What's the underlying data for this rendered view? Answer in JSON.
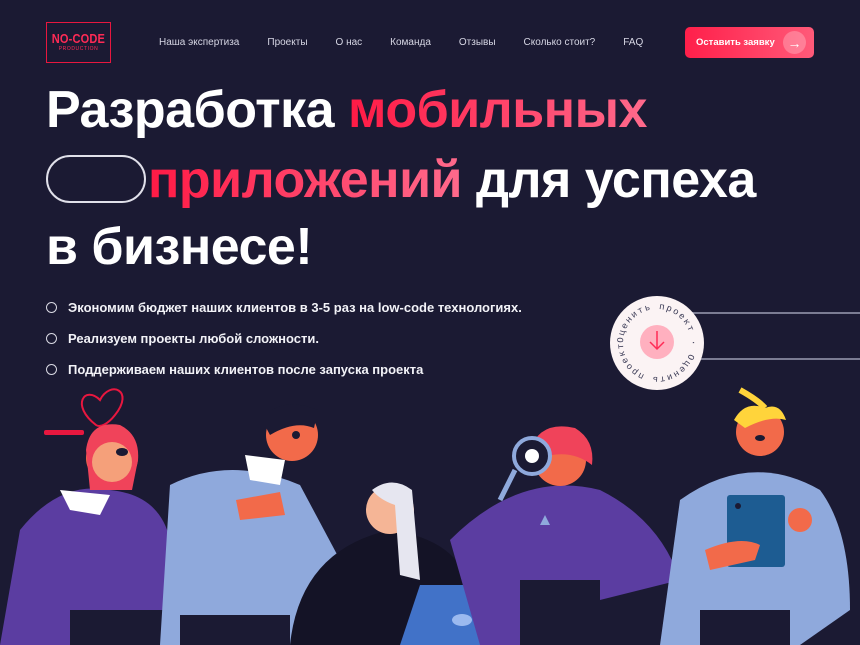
{
  "logo": {
    "main": "NO-CODE",
    "sub": "PRODUCTION"
  },
  "nav": {
    "items": [
      "Наша экспертиза",
      "Проекты",
      "О нас",
      "Команда",
      "Отзывы",
      "Сколько стоит?",
      "FAQ"
    ]
  },
  "cta": {
    "label": "Оставить заявку"
  },
  "hero": {
    "line1_white": "Разработка ",
    "line1_red": "мобильных",
    "line2_red": "приложений",
    "line2_white": " для успеха",
    "line3": "в бизнесе!"
  },
  "bullets": [
    "Экономим бюджет наших клиентов в 3-5 раз на low-code технологиях.",
    "Реализуем проекты любой сложности.",
    "Поддерживаем наших клиентов после запуска проекта"
  ],
  "badge": {
    "text": "Оценить проект · Оценить проект ·"
  },
  "colors": {
    "bg": "#1b1a33",
    "accent": "#ff1f4a",
    "purple": "#5b3da1",
    "lightblue": "#8fa9dc"
  }
}
